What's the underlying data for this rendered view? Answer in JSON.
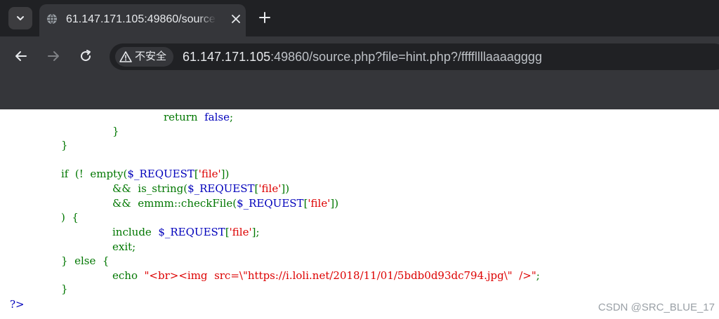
{
  "browser": {
    "tab_title": "61.147.171.105:49860/source.php?file=hint.php?/ffffllllaaaagggg",
    "security_label": "不安全",
    "url_host": "61.147.171.105",
    "url_rest": ":49860/source.php?file=hint.php?/ffffllllaaaagggg"
  },
  "code": {
    "l1": {
      "a": "return",
      "b": "false",
      "c": ";"
    },
    "l2": "}",
    "l3": "}",
    "l4": {
      "a": "if",
      "b": "(!",
      "c": "empty(",
      "d": "$_REQUEST",
      "e": "[",
      "f": "'file'",
      "g": "])"
    },
    "l5": {
      "a": "&&",
      "b": "is_string(",
      "c": "$_REQUEST",
      "d": "[",
      "e": "'file'",
      "f": "])"
    },
    "l6": {
      "a": "&&",
      "b": "emmm::checkFile(",
      "c": "$_REQUEST",
      "d": "[",
      "e": "'file'",
      "f": "])"
    },
    "l7": ")  {",
    "l8": {
      "a": "include",
      "b": "$_REQUEST",
      "c": "[",
      "d": "'file'",
      "e": "];"
    },
    "l9": "exit;",
    "l10": "}  else  {",
    "l11": {
      "a": "echo",
      "b": "\"<br><img  src=\\\"https://i.loli.net/2018/11/01/5bdb0d93dc794.jpg\\\"  />\"",
      "c": ";"
    },
    "l12": "}",
    "l13": "?>"
  },
  "watermark": "CSDN @SRC_BLUE_17"
}
